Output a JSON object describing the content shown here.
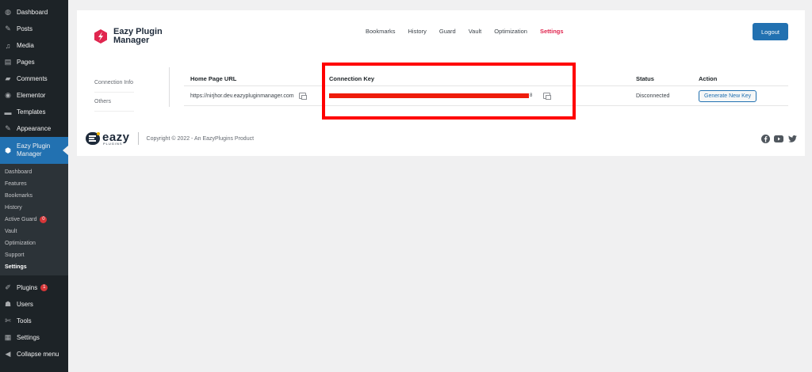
{
  "sidebar": {
    "top_items": [
      {
        "label": "Dashboard",
        "icon": "dashboard-icon",
        "glyph": "◍"
      },
      {
        "label": "Posts",
        "icon": "pin-icon",
        "glyph": "✎"
      },
      {
        "label": "Media",
        "icon": "media-icon",
        "glyph": "♫"
      },
      {
        "label": "Pages",
        "icon": "pages-icon",
        "glyph": "▤"
      },
      {
        "label": "Comments",
        "icon": "comments-icon",
        "glyph": "▰"
      },
      {
        "label": "Elementor",
        "icon": "elementor-icon",
        "glyph": "◉"
      },
      {
        "label": "Templates",
        "icon": "templates-icon",
        "glyph": "▬"
      },
      {
        "label": "Appearance",
        "icon": "appearance-icon",
        "glyph": "✎"
      }
    ],
    "current_item": {
      "label_line1": "Eazy Plugin",
      "label_line2": "Manager"
    },
    "submenu": [
      {
        "label": "Dashboard"
      },
      {
        "label": "Features"
      },
      {
        "label": "Bookmarks"
      },
      {
        "label": "History"
      },
      {
        "label": "Active Guard",
        "badge": "0"
      },
      {
        "label": "Vault"
      },
      {
        "label": "Optimization"
      },
      {
        "label": "Support"
      },
      {
        "label": "Settings"
      }
    ],
    "bottom_items": [
      {
        "label": "Plugins",
        "badge": "1",
        "icon": "plugins-icon",
        "glyph": "✐"
      },
      {
        "label": "Users",
        "icon": "users-icon",
        "glyph": "☗"
      },
      {
        "label": "Tools",
        "icon": "tools-icon",
        "glyph": "✄"
      },
      {
        "label": "Settings",
        "icon": "settings-icon",
        "glyph": "▦"
      },
      {
        "label": "Collapse menu",
        "icon": "collapse-icon",
        "glyph": "◀"
      }
    ]
  },
  "header": {
    "logo_line1": "Eazy Plugin",
    "logo_line2": "Manager",
    "nav": [
      "Bookmarks",
      "History",
      "Guard",
      "Vault",
      "Optimization",
      "Settings"
    ],
    "active_nav": "Settings",
    "logout_label": "Logout"
  },
  "side_tabs": [
    "Connection Info",
    "Others"
  ],
  "table": {
    "headers": [
      "Home Page URL",
      "Connection Key",
      "Status",
      "Action"
    ],
    "row": {
      "url": "https://nirjhor.dev.eazypluginmanager.com",
      "key_tail": "8",
      "status": "Disconnected",
      "action_label": "Generate New Key"
    }
  },
  "footer": {
    "brand_word": "eazy",
    "brand_sub": "PLUGINS",
    "copyright": "Copyright © 2022 - An EazyPlugins Product"
  },
  "colors": {
    "wp_sidebar": "#1d2327",
    "wp_accent": "#2271b1",
    "nav_active": "#e0264f",
    "redaction": "#ee1c0b",
    "highlight_box": "#ff0000"
  }
}
